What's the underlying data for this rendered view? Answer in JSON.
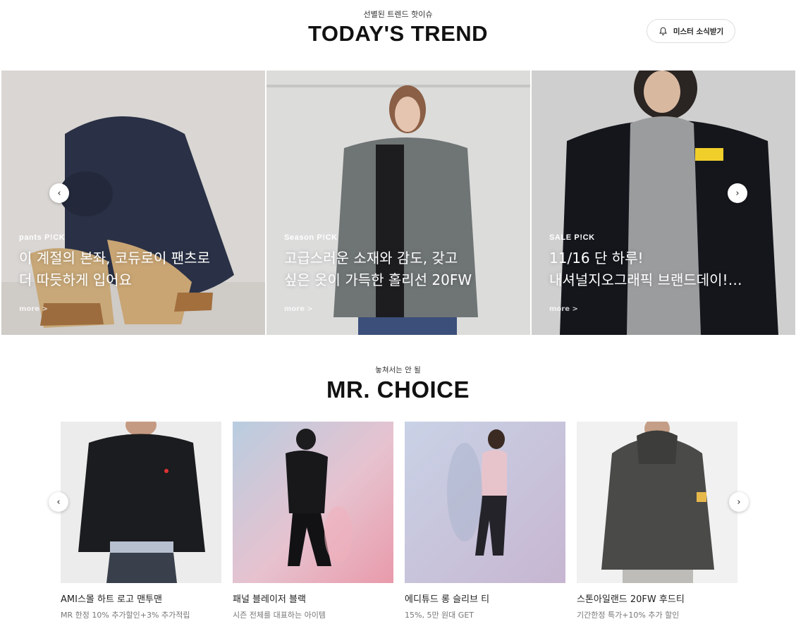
{
  "trend": {
    "eyebrow": "선별된 트렌드 핫이슈",
    "title": "TODAY'S TREND",
    "notice_button": "미스터 소식받기",
    "cards": [
      {
        "tag": "pants P!CK",
        "headline": "이 계절의 본좌, 코듀로이 팬츠로\n더 따듯하게 입어요",
        "more": "more >"
      },
      {
        "tag": "Season P!CK",
        "headline": "고급스러운 소재와 감도, 갖고\n싶은 옷이 가득한 홀리선 20FW",
        "more": "more >"
      },
      {
        "tag": "SALE P!CK",
        "headline": "11/16 단 하루!\n내셔널지오그래픽 브랜드데이!…",
        "more": "more >"
      }
    ],
    "prev_arrow": "‹",
    "next_arrow": "›"
  },
  "choice": {
    "eyebrow": "놓쳐서는 안 될",
    "title": "MR. CHOICE",
    "products": [
      {
        "name": "AMI스몰 하트 로고 맨투맨",
        "sub": "MR 한정 10% 추가할인+3% 추가적립"
      },
      {
        "name": "패널 블레이저 블랙",
        "sub": "시즌 전체를 대표하는 아이템"
      },
      {
        "name": "에디튜드 롱 슬리브 티",
        "sub": "15%, 5만 원대 GET"
      },
      {
        "name": "스톤아일랜드 20FW 후드티",
        "sub": "기간한정 특가+10% 추가 할인"
      }
    ],
    "prev_arrow": "‹",
    "next_arrow": "›"
  },
  "icons": [
    "bell-icon",
    "chevron-left-icon",
    "chevron-right-icon"
  ]
}
